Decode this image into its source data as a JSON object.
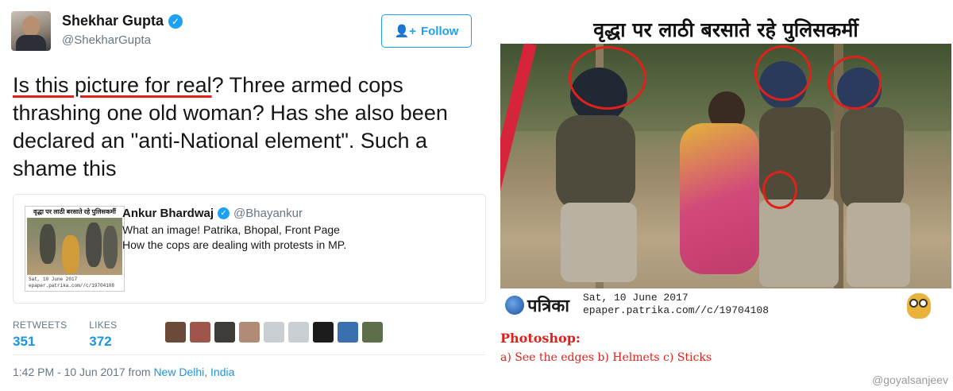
{
  "tweet": {
    "author_name": "Shekhar Gupta",
    "author_handle": "@ShekharGupta",
    "follow_label": "Follow",
    "text_highlight": "Is this picture for real",
    "text_rest": "? Three armed cops thrashing one old woman? Has she also been declared an \"anti-National element\". Such a shame this",
    "quote": {
      "author_name": "Ankur Bhardwaj",
      "author_handle": "@Bhayankur",
      "line1": "What an image! Patrika, Bhopal, Front Page",
      "line2": "How the cops are dealing with protests in MP.",
      "thumb_headline": "वृद्धा पर लाठी बरसाते रहे पुलिसकर्मी",
      "thumb_date": "Sat, 10 June 2017",
      "thumb_url": "epaper.patrika.com//c/19704108"
    },
    "retweets_label": "RETWEETS",
    "retweets": "351",
    "likes_label": "LIKES",
    "likes": "372",
    "time": "1:42 PM - 10 Jun 2017 from ",
    "location_city": "New Delhi",
    "location_sep": ", ",
    "location_country": "India",
    "liker_colors": [
      "#6b4a3a",
      "#a0554c",
      "#3e3b38",
      "#b08b76",
      "#c9ced3",
      "#c9ced3",
      "#1c1c1c",
      "#3a6fb0",
      "#5d6e4a"
    ]
  },
  "paper": {
    "headline": "वृद्धा पर लाठी बरसाते रहे पुलिसकर्मी",
    "logo_text": "पत्रिका",
    "date": "Sat, 10 June 2017",
    "url": "epaper.patrika.com//c/19704108",
    "photoshop_title": "Photoshop:",
    "photoshop_points": "a) See the edges b) Helmets c) Sticks",
    "watermark": "@goyalsanjeev"
  },
  "colors": {
    "twitter_blue": "#1da1f2",
    "link_blue": "#1b95e0",
    "annotation_red": "#e0201b"
  }
}
